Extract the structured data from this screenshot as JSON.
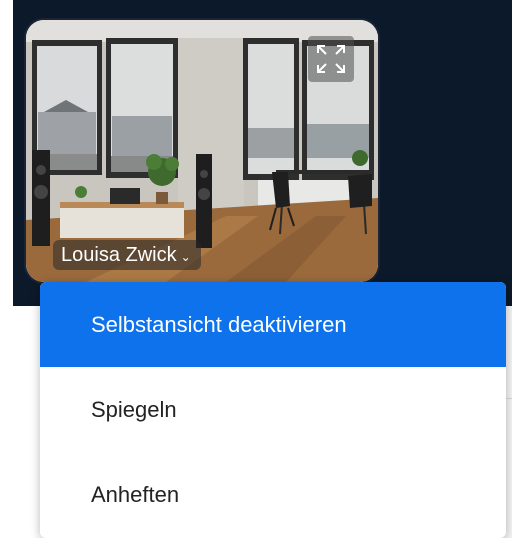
{
  "video_tile": {
    "participant_name": "Louisa Zwick",
    "name_dropdown_icon": "chevron-down-icon",
    "fullscreen_icon": "expand-icon"
  },
  "context_menu": {
    "items": [
      {
        "label": "Selbstansicht deaktivieren",
        "highlighted": true
      },
      {
        "label": "Spiegeln",
        "highlighted": false
      },
      {
        "label": "Anheften",
        "highlighted": false
      }
    ]
  },
  "colors": {
    "background_dark": "#0c192a",
    "menu_highlight": "#0e72ed",
    "menu_text": "#232323"
  }
}
